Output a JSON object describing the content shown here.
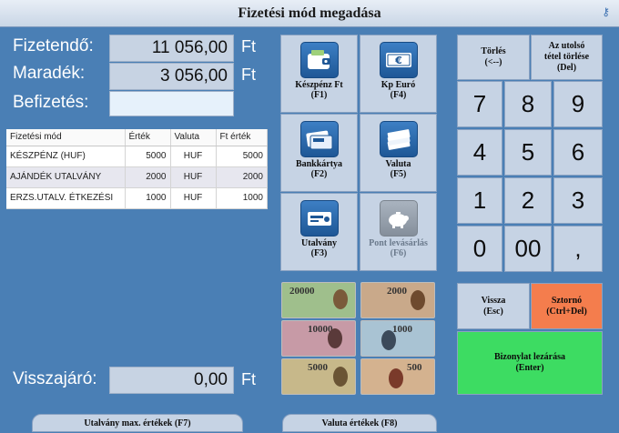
{
  "window": {
    "title": "Fizetési mód megadása"
  },
  "amounts": {
    "due_label": "Fizetendő:",
    "due_value": "11 056,00",
    "due_currency": "Ft",
    "remaining_label": "Maradék:",
    "remaining_value": "3 056,00",
    "remaining_currency": "Ft",
    "payment_label": "Befizetés:",
    "payment_value": "",
    "change_label": "Visszajáró:",
    "change_value": "0,00",
    "change_currency": "Ft"
  },
  "payment_table": {
    "columns": [
      "Fizetési mód",
      "Érték",
      "Valuta",
      "Ft érték"
    ],
    "rows": [
      [
        "KÉSZPÉNZ (HUF)",
        "5000",
        "HUF",
        "5000"
      ],
      [
        "AJÁNDÉK UTALVÁNY",
        "2000",
        "HUF",
        "2000"
      ],
      [
        "ERZS.UTALV. ÉTKEZÉSI",
        "1000",
        "HUF",
        "1000"
      ]
    ]
  },
  "payment_methods": [
    {
      "line1": "Készpénz Ft",
      "line2": "(F1)",
      "icon": "wallet-icon",
      "enabled": true
    },
    {
      "line1": "Kp Euró",
      "line2": "(F4)",
      "icon": "euro-banknote-icon",
      "enabled": true
    },
    {
      "line1": "Bankkártya",
      "line2": "(F2)",
      "icon": "bank-card-icon",
      "enabled": true
    },
    {
      "line1": "Valuta",
      "line2": "(F5)",
      "icon": "banknote-stack-icon",
      "enabled": true
    },
    {
      "line1": "Utalvány",
      "line2": "(F3)",
      "icon": "voucher-icon",
      "enabled": true
    },
    {
      "line1": "Pont levásárlás",
      "line2": "(F6)",
      "icon": "piggy-bank-icon",
      "enabled": false
    }
  ],
  "banknotes": [
    {
      "denomination": "20000",
      "color": "#9fbf8c"
    },
    {
      "denomination": "2000",
      "color": "#c9a98a"
    },
    {
      "denomination": "10000",
      "color": "#c79aa6"
    },
    {
      "denomination": "1000",
      "color": "#a9c3d3"
    },
    {
      "denomination": "5000",
      "color": "#c7b88a"
    },
    {
      "denomination": "500",
      "color": "#d4b28f"
    }
  ],
  "keypad": {
    "clear_line1": "Törlés",
    "clear_line2": "(<--)",
    "delete_line1": "Az utolsó",
    "delete_line2": "tétel törlése",
    "delete_line3": "(Del)",
    "keys": [
      "7",
      "8",
      "9",
      "4",
      "5",
      "6",
      "1",
      "2",
      "3",
      "0",
      "00",
      ","
    ]
  },
  "actions": {
    "back_line1": "Vissza",
    "back_line2": "(Esc)",
    "cancel_line1": "Sztornó",
    "cancel_line2": "(Ctrl+Del)",
    "close_line1": "Bizonylat lezárása",
    "close_line2": "(Enter)",
    "voucher_max_label": "Utalvány max. értékek (F7)",
    "currency_values_label": "Valuta értékek (F8)"
  },
  "colors": {
    "background": "#4a7fb5",
    "button": "#c6d3e4",
    "cancel": "#f47d4d",
    "confirm": "#3ddc62"
  }
}
